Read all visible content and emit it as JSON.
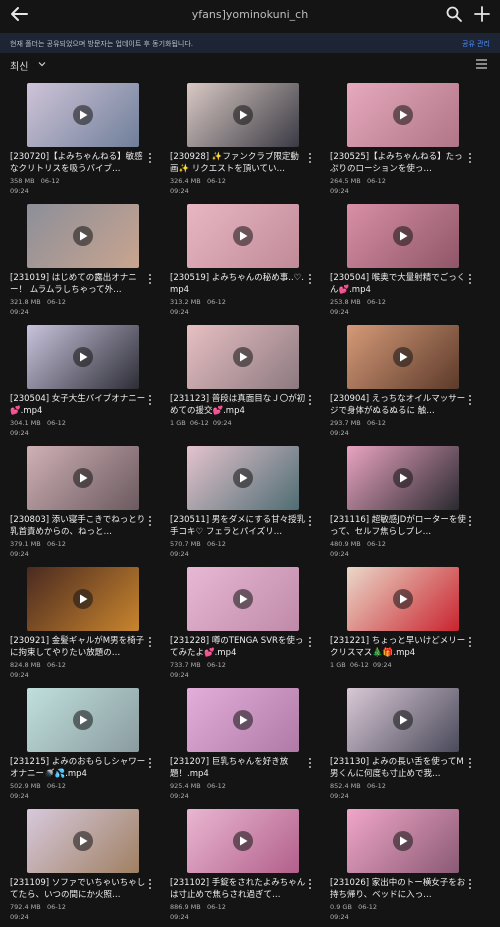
{
  "header": {
    "title": "yfans]yominokuni_ch",
    "icons": [
      "back-arrow-icon",
      "search-icon",
      "plus-icon"
    ]
  },
  "banner": {
    "message": "현재 폴더는 공유되었으며 방문자는 업데이트 후 동기화됩니다.",
    "link": "공유 관리"
  },
  "sort": {
    "label": "최신"
  },
  "files": [
    {
      "title": "[230720]【よみちゃんねる】敏感なクリトリスを吸うバイブ…",
      "size": "358 MB",
      "date": "06-12",
      "time": "09:24",
      "tone": [
        "#cfc4d8",
        "#6f7f9a"
      ]
    },
    {
      "title": "[230928] ✨ファンクラブ限定動画✨ リクエストを頂いてい…",
      "size": "326.4 MB",
      "date": "06-12",
      "time": "09:24",
      "tone": [
        "#d9c9c4",
        "#3a3a44"
      ]
    },
    {
      "title": "[230525]【よみちゃんねる】たっぷりのローションを使っ…",
      "size": "264.5 MB",
      "date": "06-12",
      "time": "09:24",
      "tone": [
        "#e6a9be",
        "#b07586"
      ]
    },
    {
      "title": "[231019] はじめての露出オナニー！ ムラムラしちゃって外…",
      "size": "321.8 MB",
      "date": "06-12",
      "time": "09:24",
      "tone": [
        "#8c8f99",
        "#c9a48f"
      ]
    },
    {
      "title": "[230519] よみちゃんの秘め事..♡.mp4",
      "size": "313.2 MB",
      "date": "06-12",
      "time": "09:24",
      "tone": [
        "#e8b7c3",
        "#c18a98"
      ]
    },
    {
      "title": "[230504] 喉奥で大量射精でごっくん💕.mp4",
      "size": "253.8 MB",
      "date": "06-12",
      "time": "09:24",
      "tone": [
        "#d98fa6",
        "#8f5668"
      ]
    },
    {
      "title": "[230504] 女子大生バイブオナニー💕.mp4",
      "size": "304.1 MB",
      "date": "06-12",
      "time": "09:24",
      "tone": [
        "#c8c3dc",
        "#2d2d36"
      ]
    },
    {
      "title": "[231123] 普段は真面目なＪ〇が初めての援交💕.mp4",
      "size": "1 GB",
      "date": "06-12",
      "time": "09:24",
      "tone": [
        "#e7bfc2",
        "#8c7a80"
      ],
      "inline_time": true
    },
    {
      "title": "[230904] えっちなオイルマッサージで身体がぬるぬるに 触…",
      "size": "293.7 MB",
      "date": "06-12",
      "time": "09:24",
      "tone": [
        "#d59a78",
        "#5c3a2a"
      ]
    },
    {
      "title": "[230803] 添い寝手こきでねっとり乳首責めからの、ねっと…",
      "size": "379.1 MB",
      "date": "06-12",
      "time": "09:24",
      "tone": [
        "#cfb0b5",
        "#6a5a5f"
      ]
    },
    {
      "title": "[230511] 男をダメにする甘々授乳手コキ♡ フェラとパイズリ…",
      "size": "570.7 MB",
      "date": "06-12",
      "time": "09:24",
      "tone": [
        "#e4c3cd",
        "#4e6d73"
      ]
    },
    {
      "title": "[231116] 超敏感JDがローターを使って、セルフ焦らしプレ…",
      "size": "480.9 MB",
      "date": "06-12",
      "time": "09:24",
      "tone": [
        "#e9a3c1",
        "#2a2a30"
      ]
    },
    {
      "title": "[230921] 金髪ギャルがM男を椅子に拘束してやりたい放題の…",
      "size": "824.8 MB",
      "date": "06-12",
      "time": "09:24",
      "tone": [
        "#4a2a20",
        "#c9852e"
      ]
    },
    {
      "title": "[231228] 噂のTENGA SVRを使ってみたよ💕.mp4",
      "size": "733.7 MB",
      "date": "06-12",
      "time": "09:24",
      "tone": [
        "#e7b8d4",
        "#bf8aa8"
      ]
    },
    {
      "title": "[231221] ちょっと早いけどメリークリスマス🎄🎁.mp4",
      "size": "1 GB",
      "date": "06-12",
      "time": "09:24",
      "tone": [
        "#ead8c8",
        "#c9242f"
      ],
      "inline_time": true
    },
    {
      "title": "[231215] よみのおもらしシャワーオナニー🚿💦.mp4",
      "size": "502.9 MB",
      "date": "06-12",
      "time": "09:24",
      "tone": [
        "#bfe0dc",
        "#8b9ba0"
      ]
    },
    {
      "title": "[231207] 巨乳ちゃんを好き放題！.mp4",
      "size": "925.4 MB",
      "date": "06-12",
      "time": "09:24",
      "tone": [
        "#e4aedb",
        "#b07aa6"
      ]
    },
    {
      "title": "[231130] よみの長い舌を使ってM男くんに何度も寸止めで我…",
      "size": "852.4 MB",
      "date": "06-12",
      "time": "09:24",
      "tone": [
        "#d9c8d6",
        "#4a4a5a"
      ]
    },
    {
      "title": "[231109] ソファでいちゃいちゃしてたら、いつの間にか火照…",
      "size": "792.4 MB",
      "date": "06-12",
      "time": "09:24",
      "tone": [
        "#d7c9dc",
        "#a08062"
      ]
    },
    {
      "title": "[231102] 手錠をされたよみちゃんは寸止めで焦らされ過ぎて…",
      "size": "886.9 MB",
      "date": "06-12",
      "time": "09:24",
      "tone": [
        "#e9b6d1",
        "#b2608b"
      ]
    },
    {
      "title": "[231026] 家出中のトー横女子をお持ち帰り、ベッドに入っ…",
      "size": "0.9 GB",
      "date": "06-12",
      "time": "09:24",
      "tone": [
        "#f0a6c8",
        "#8a5a74"
      ]
    }
  ]
}
